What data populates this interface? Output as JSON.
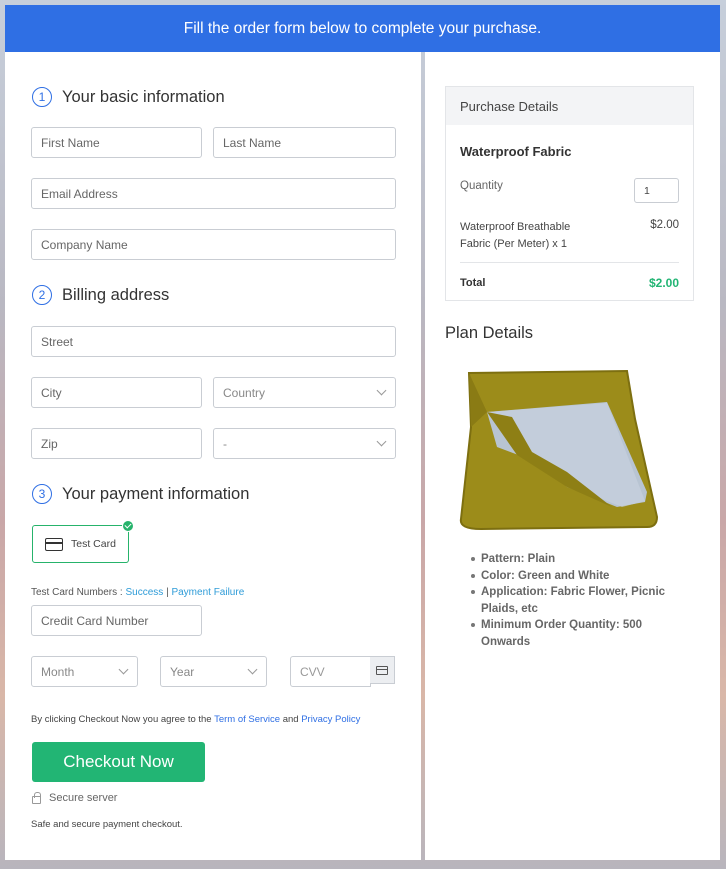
{
  "banner": "Fill the order form below to complete your purchase.",
  "basic": {
    "step": "1",
    "title": "Your basic information",
    "first_name": "First Name",
    "last_name": "Last Name",
    "email": "Email Address",
    "company": "Company Name"
  },
  "billing": {
    "step": "2",
    "title": "Billing address",
    "street": "Street",
    "city": "City",
    "country": "Country",
    "zip": "Zip",
    "state": "-"
  },
  "payment": {
    "step": "3",
    "title": "Your payment information",
    "test_card": "Test Card",
    "test_numbers_label": "Test Card Numbers :",
    "success": "Success",
    "separator": "|",
    "failure": "Payment Failure",
    "card_number": "Credit Card Number",
    "month": "Month",
    "year": "Year",
    "cvv": "CVV"
  },
  "terms": {
    "prefix": "By clicking Checkout Now you agree to the",
    "terms_link": "Term of Service",
    "and": "and",
    "privacy_link": "Privacy Policy"
  },
  "checkout_label": "Checkout Now",
  "secure_server": "Secure server",
  "safe_text": "Safe and secure payment checkout.",
  "purchase": {
    "header": "Purchase Details",
    "product": "Waterproof Fabric",
    "quantity_label": "Quantity",
    "quantity": "1",
    "item_name": "Waterproof Breathable Fabric (Per Meter) x 1",
    "item_price": "$2.00",
    "total_label": "Total",
    "total": "$2.00"
  },
  "plan": {
    "title": "Plan Details",
    "features": [
      "Pattern: Plain",
      "Color: Green and White",
      "Application: Fabric Flower, Picnic Plaids, etc",
      "Minimum Order Quantity: 500 Onwards"
    ]
  },
  "colors": {
    "primary": "#2f6fe4",
    "accent_green": "#22b574"
  }
}
